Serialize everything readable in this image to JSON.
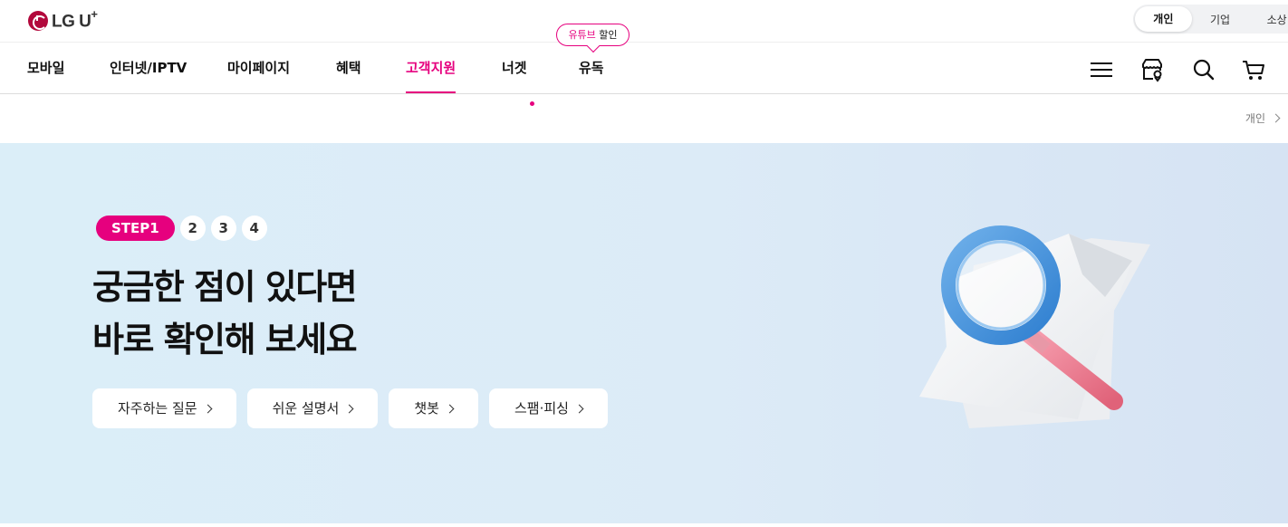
{
  "brand": {
    "name": "LG U",
    "sup": "+"
  },
  "segment": {
    "items": [
      "개인",
      "기업",
      "소상"
    ],
    "active": 0
  },
  "nav": {
    "items": [
      "모바일",
      "인터넷/IPTV",
      "마이페이지",
      "혜택",
      "고객지원",
      "너겟",
      "유독"
    ],
    "active": "고객지원",
    "promo_bubble": {
      "highlight": "유튜브",
      "rest": " 할인"
    }
  },
  "icons": [
    "menu-icon",
    "store-icon",
    "search-icon",
    "cart-icon"
  ],
  "breadcrumb": {
    "label": "개인"
  },
  "hero": {
    "step_label": "STEP1",
    "steps": [
      "2",
      "3",
      "4"
    ],
    "headline_line1": "궁금한 점이 있다면",
    "headline_line2": "바로 확인해 보세요",
    "buttons": [
      "자주하는 질문",
      "쉬운 설명서",
      "챗봇",
      "스팸·피싱"
    ]
  },
  "colors": {
    "accent": "#e6007e",
    "brand": "#b2083c",
    "hero_bg": "#dbeef8"
  }
}
